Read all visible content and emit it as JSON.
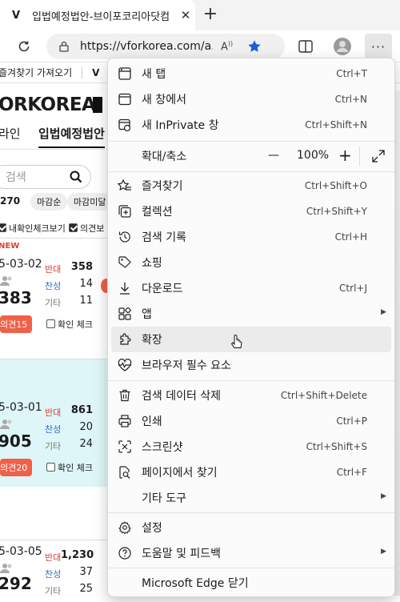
{
  "browser": {
    "tab_title": "입법예정법안-브이포코리아닷컴",
    "tab_favicon": "V",
    "address": "https://vforkorea.com/a...",
    "favorites_bar": {
      "import_label": "즐겨찾기 가져오기",
      "item_label": "V"
    }
  },
  "page": {
    "logo_text": "ORKOREA",
    "nav": [
      "라인",
      "입법예정법안"
    ],
    "search_placeholder": "검색",
    "total_count": "270",
    "sort_chips": [
      "마감순",
      "마감미달"
    ],
    "filters": [
      "내확인체크보기",
      "의견보"
    ],
    "cards": [
      {
        "new_label": "NEW",
        "date": "5-03-02",
        "count": "383",
        "oppose_label": "반대",
        "oppose": "358",
        "support_label": "찬성",
        "support": "14",
        "other_label": "기타",
        "other": "11",
        "badge": "의견15",
        "check_label": "확인 체크"
      },
      {
        "date": "5-03-01",
        "count": "905",
        "oppose_label": "반대",
        "oppose": "861",
        "support_label": "찬성",
        "support": "20",
        "other_label": "기타",
        "other": "24",
        "badge": "의견20",
        "check_label": "확인 체크"
      },
      {
        "date": "5-03-05",
        "count": "292",
        "oppose_label": "반대",
        "oppose": "1,230",
        "support_label": "찬성",
        "support": "37",
        "other_label": "기타",
        "other": "25"
      }
    ]
  },
  "menu": {
    "items": [
      {
        "label": "새 탭",
        "shortcut": "Ctrl+T",
        "icon": "new-tab-icon"
      },
      {
        "label": "새 창에서",
        "shortcut": "Ctrl+N",
        "icon": "new-window-icon"
      },
      {
        "label": "새 InPrivate 창",
        "shortcut": "Ctrl+Shift+N",
        "icon": "inprivate-icon"
      },
      {
        "label": "즐겨찾기",
        "shortcut": "Ctrl+Shift+O",
        "icon": "favorites-icon"
      },
      {
        "label": "컬렉션",
        "shortcut": "Ctrl+Shift+Y",
        "icon": "collections-icon"
      },
      {
        "label": "검색 기록",
        "shortcut": "Ctrl+H",
        "icon": "history-icon"
      },
      {
        "label": "쇼핑",
        "shortcut": "",
        "icon": "shopping-tag-icon"
      },
      {
        "label": "다운로드",
        "shortcut": "Ctrl+J",
        "icon": "download-icon"
      },
      {
        "label": "앱",
        "shortcut": "",
        "icon": "apps-icon"
      },
      {
        "label": "확장",
        "shortcut": "",
        "icon": "extensions-icon"
      },
      {
        "label": "브라우저 필수 요소",
        "shortcut": "",
        "icon": "heartbeat-icon"
      },
      {
        "label": "검색 데이터 삭제",
        "shortcut": "Ctrl+Shift+Delete",
        "icon": "trash-icon"
      },
      {
        "label": "인쇄",
        "shortcut": "Ctrl+P",
        "icon": "print-icon"
      },
      {
        "label": "스크린샷",
        "shortcut": "Ctrl+Shift+S",
        "icon": "screenshot-icon"
      },
      {
        "label": "페이지에서 찾기",
        "shortcut": "Ctrl+F",
        "icon": "find-icon"
      },
      {
        "label": "기타 도구",
        "shortcut": "",
        "icon": ""
      },
      {
        "label": "설정",
        "shortcut": "",
        "icon": "settings-icon"
      },
      {
        "label": "도움말 및 피드백",
        "shortcut": "",
        "icon": "help-icon"
      },
      {
        "label": "Microsoft Edge 닫기",
        "shortcut": "",
        "icon": ""
      }
    ],
    "zoom": {
      "label": "확대/축소",
      "value": "100%",
      "minus": "—",
      "plus": "+"
    }
  }
}
